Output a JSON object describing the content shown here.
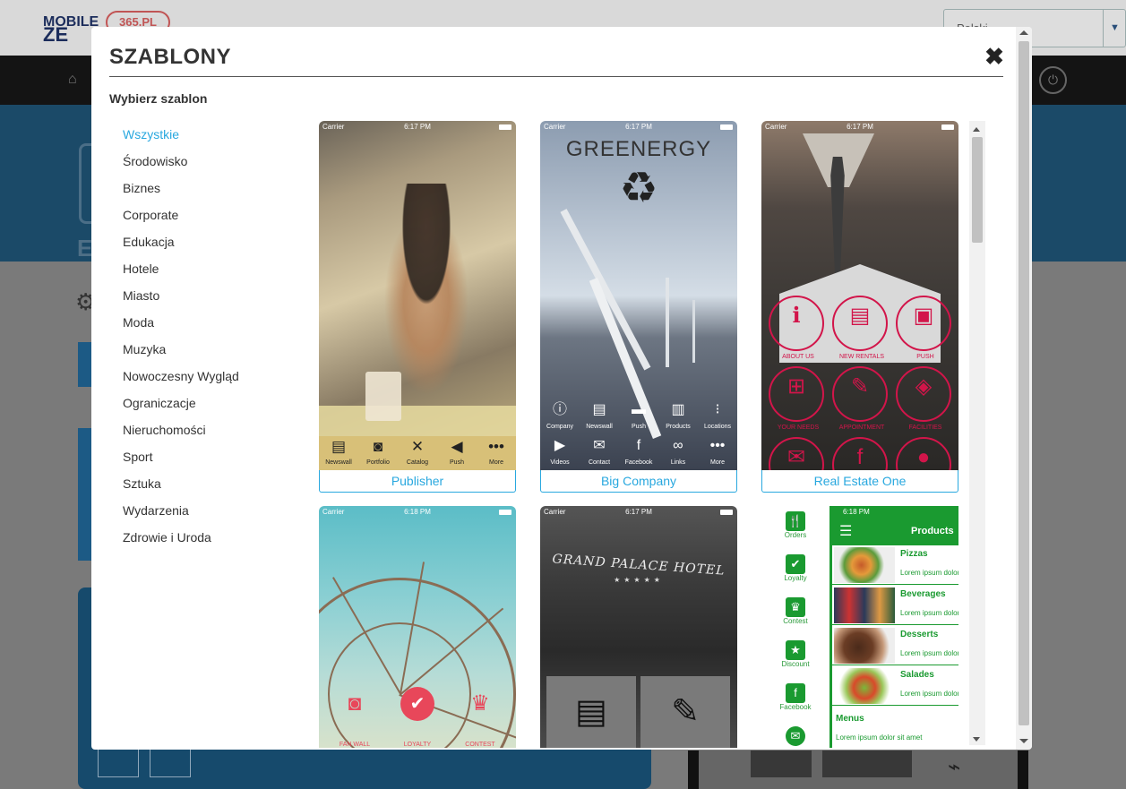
{
  "background": {
    "logo_line1": "MOBILE",
    "logo_line2": "ZE",
    "logo_badge": "365.PL",
    "language": "Polski",
    "hero_letter": "E"
  },
  "modal": {
    "title": "SZABLONY",
    "close_icon": "close-icon",
    "subtitle": "Wybierz szablon",
    "categories": [
      "Wszystkie",
      "Środowisko",
      "Biznes",
      "Corporate",
      "Edukacja",
      "Hotele",
      "Miasto",
      "Moda",
      "Muzyka",
      "Nowoczesny Wygląd",
      "Ograniczacje",
      "Nieruchomości",
      "Sport",
      "Sztuka",
      "Wydarzenia",
      "Zdrowie i Uroda"
    ],
    "active_category": "Wszystkie"
  },
  "templates": [
    {
      "name": "Publisher",
      "status": {
        "carrier": "Carrier",
        "time": "6:17 PM"
      },
      "tabs": [
        "Newswall",
        "Portfolio",
        "Catalog",
        "Push",
        "More"
      ]
    },
    {
      "name": "Big Company",
      "status": {
        "carrier": "Carrier",
        "time": "6:17 PM"
      },
      "brand": "GREENERGY",
      "tabs_row1": [
        "Company",
        "Newswall",
        "Push",
        "Products",
        "Locations"
      ],
      "tabs_row2": [
        "Videos",
        "Contact",
        "Facebook",
        "Links",
        "More"
      ]
    },
    {
      "name": "Real Estate One",
      "status": {
        "carrier": "Carrier",
        "time": "6:17 PM"
      },
      "circles": [
        "ABOUT US",
        "NEW RENTALS",
        "PUSH",
        "YOUR NEEDS",
        "APPOINTMENT",
        "FACILITIES"
      ]
    },
    {
      "name": "",
      "status": {
        "carrier": "Carrier",
        "time": "6:18 PM"
      },
      "circles": [
        "FAN WALL",
        "LOYALTY",
        "CONTEST"
      ]
    },
    {
      "name": "",
      "status": {
        "carrier": "Carrier",
        "time": "6:17 PM"
      },
      "hotel_name": "GRAND PALACE HOTEL",
      "stars": "★★★★★"
    },
    {
      "name": "",
      "status": {
        "time": "6:18 PM"
      },
      "side_items": [
        "Orders",
        "Loyalty",
        "Contest",
        "Discount",
        "Facebook"
      ],
      "header_title": "Products",
      "rows": [
        {
          "name": "Pizzas",
          "desc": "Lorem ipsum dolor"
        },
        {
          "name": "Beverages",
          "desc": "Lorem ipsum dolor"
        },
        {
          "name": "Desserts",
          "desc": "Lorem ipsum dolor"
        },
        {
          "name": "Salades",
          "desc": "Lorem ipsum dolor"
        }
      ],
      "menus_title": "Menus",
      "menus_desc": "Lorem ipsum dolor sit amet"
    }
  ],
  "colors": {
    "accent": "#29a8df",
    "realestate": "#d2154a",
    "food_green": "#1a9a30"
  }
}
